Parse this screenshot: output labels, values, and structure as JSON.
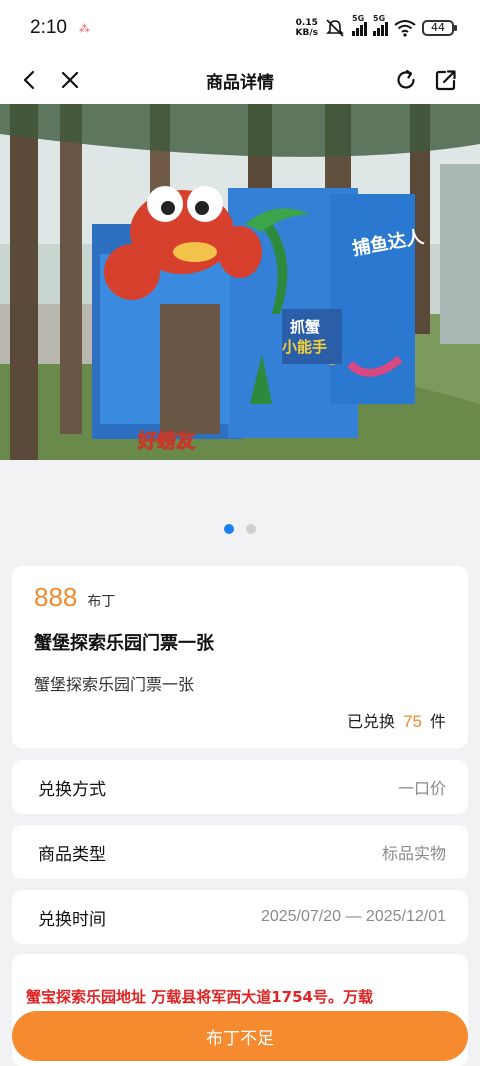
{
  "status_bar": {
    "time": "2:10",
    "notification_glyph": "⁂",
    "net_speed_value": "0.15",
    "net_speed_unit": "KB/s",
    "sim1_label": "5G",
    "sim2_label": "5G",
    "battery": "44"
  },
  "nav": {
    "title": "商品详情",
    "icons": [
      "back-icon",
      "close-icon",
      "refresh-icon",
      "share-icon"
    ]
  },
  "hero": {
    "image_text_1": "捕鱼达人",
    "image_text_2": "抓蟹",
    "image_text_3": "小能手",
    "image_text_4": "好螃友",
    "slide_count": 2,
    "active_slide": 1
  },
  "product": {
    "price": "888",
    "price_unit": "布丁",
    "title": "蟹堡探索乐园门票一张",
    "description": "蟹堡探索乐园门票一张",
    "exchanged_prefix": "已兑换",
    "exchanged_count": "75",
    "exchanged_suffix": "件"
  },
  "details": [
    {
      "label": "兑换方式",
      "value": "一口价"
    },
    {
      "label": "商品类型",
      "value": "标品实物"
    },
    {
      "label": "兑换时间",
      "value": "2025/07/20 — 2025/12/01"
    }
  ],
  "address": {
    "text": "蟹宝探索乐园地址 万载县将军西大道1754号。万载"
  },
  "cta": {
    "label": "布丁不足"
  },
  "colors": {
    "accent_orange": "#f58a2f",
    "price_orange": "#f08a2c",
    "address_red": "#e02424",
    "dot_active": "#1a7ff0"
  }
}
